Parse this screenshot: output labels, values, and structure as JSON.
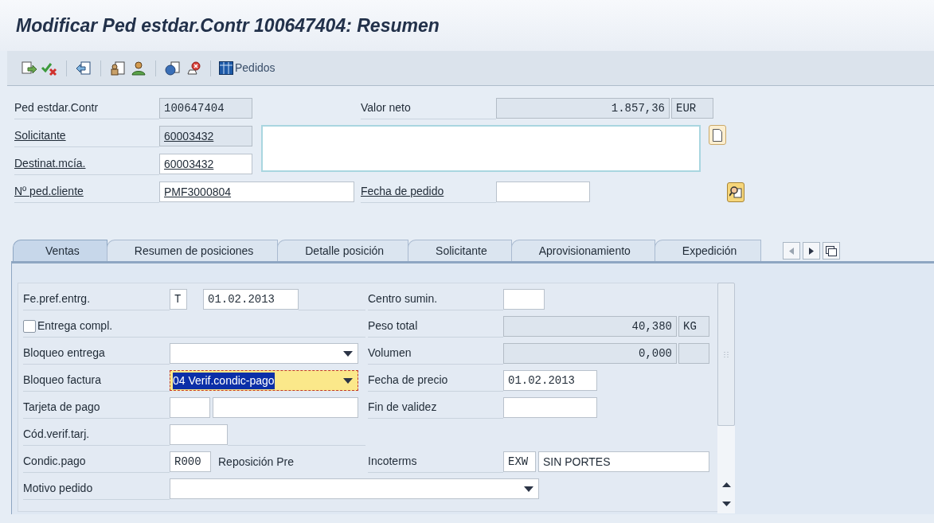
{
  "window": {
    "title": "Modificar Ped estdar.Contr 100647404: Resumen"
  },
  "toolbar": {
    "button_label": "Pedidos"
  },
  "header": {
    "document": {
      "label": "Ped estdar.Contr",
      "value": "100647404"
    },
    "requester": {
      "label": "Solicitante",
      "value": "60003432"
    },
    "ship_to": {
      "label": "Destinat.mcía.",
      "value": "60003432"
    },
    "customer_po": {
      "label": "Nº ped.cliente",
      "value": "PMF3000804"
    },
    "net_value": {
      "label": "Valor neto",
      "value": "1.857,36",
      "unit": "EUR"
    },
    "po_date": {
      "label": "Fecha de pedido"
    }
  },
  "tabs": [
    {
      "label": "Ventas",
      "selected": true
    },
    {
      "label": "Resumen de posiciones",
      "selected": false
    },
    {
      "label": "Detalle posición",
      "selected": false
    },
    {
      "label": "Solicitante",
      "selected": false
    },
    {
      "label": "Aprovisionamiento",
      "selected": false
    },
    {
      "label": "Expedición",
      "selected": false
    }
  ],
  "sales": {
    "delivery_date": {
      "label": "Fe.pref.entrg.",
      "unit": "T",
      "value": "01.02.2013"
    },
    "complete_delivery": {
      "label": "Entrega compl.",
      "checked": false
    },
    "delivery_block": {
      "label": "Bloqueo entrega"
    },
    "billing_block": {
      "label": "Bloqueo factura",
      "value": "04 Verif.condic-pago",
      "focused": true
    },
    "payment_card": {
      "label": "Tarjeta de pago"
    },
    "card_code": {
      "label": "Cód.verif.tarj."
    },
    "payment_terms": {
      "label": "Condic.pago",
      "value": "R000",
      "description": "Reposición Pre"
    },
    "order_reason": {
      "label": "Motivo pedido"
    },
    "plant": {
      "label": "Centro sumin."
    },
    "total_weight": {
      "label": "Peso total",
      "value": "40,380",
      "unit": "KG"
    },
    "volume": {
      "label": "Volumen",
      "value": "0,000"
    },
    "pricing_date": {
      "label": "Fecha de precio",
      "value": "01.02.2013"
    },
    "valid_to": {
      "label": "Fin de validez"
    },
    "incoterms": {
      "label": "Incoterms",
      "value": "EXW",
      "description": "SIN PORTES"
    }
  }
}
